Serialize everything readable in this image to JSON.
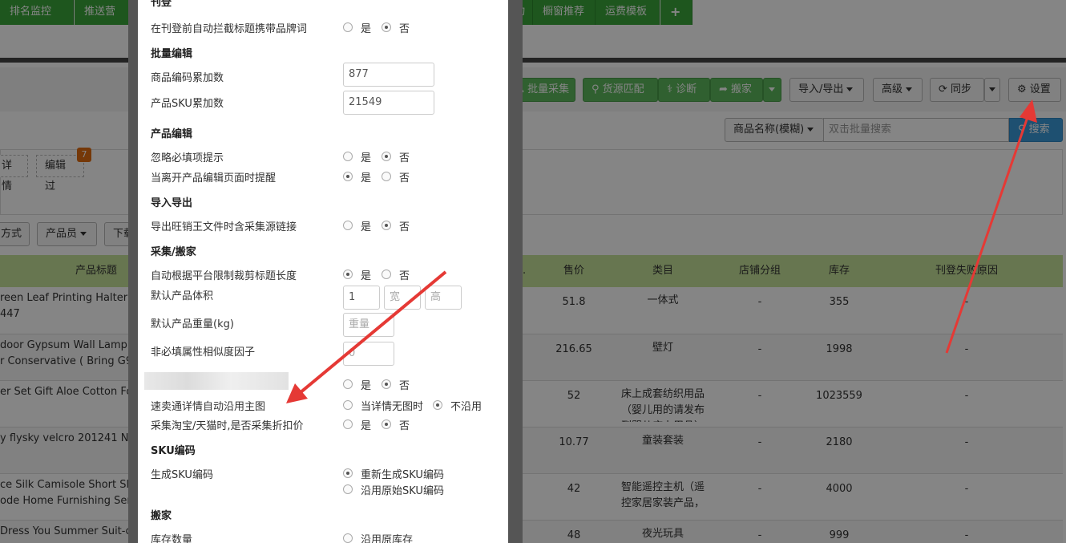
{
  "top_tabs": [
    "排名监控",
    "推送营销",
    "动",
    "橱窗推荐",
    "运费模板",
    "+"
  ],
  "toolbar": {
    "batch_collect": "批量采集",
    "source_match": "货源匹配",
    "diagnose": "诊断",
    "move": "搬家",
    "import_export": "导入/导出",
    "advanced": "高级",
    "sync": "同步",
    "settings": "设置"
  },
  "search": {
    "field_select": "商品名称(模糊)",
    "placeholder": "双击批量搜索",
    "button": "搜索"
  },
  "filters": {
    "detail_chip": "详情",
    "edited_chip": "编辑过",
    "edited_count": "7",
    "method_btn": "方式",
    "staff_btn": "产品员",
    "down_btn": "下载"
  },
  "grid": {
    "headers": {
      "title": "产品标题",
      "truncated": "...",
      "price": "售价",
      "category": "类目",
      "store_group": "店铺分组",
      "stock": "库存",
      "fail_reason": "刊登失败原因"
    },
    "rows": [
      {
        "title1": "reen Leaf Printing Halter C",
        "title2": "447",
        "price": "51.8",
        "category": "一体式",
        "group": "-",
        "stock": "355",
        "fail": "-"
      },
      {
        "title1": "door Gypsum Wall Lamp 1",
        "title2": "r Conservative ( Bring G9 l",
        "price": "216.65",
        "category": "壁灯",
        "group": "-",
        "stock": "1998",
        "fail": "-"
      },
      {
        "title1": "er Set Gift Aloe Cotton Fo",
        "title2": "",
        "price": "52",
        "category": "床上成套纺织用品（婴儿用的请发布到婴儿床上用品）",
        "group": "-",
        "stock": "1023559",
        "fail": "-"
      },
      {
        "title1": "y flysky velcro 201241 Non",
        "title2": "",
        "price": "10.77",
        "category": "童装套装",
        "group": "-",
        "stock": "2180",
        "fail": "-"
      },
      {
        "title1": "ce Silk Camisole Short Slee",
        "title2": "ode Home Furnishing Serv",
        "price": "42",
        "category": "智能遥控主机（遥控家居家装产品，",
        "group": "-",
        "stock": "4000",
        "fail": "-"
      },
      {
        "title1": "Dress You Summer Suit-c",
        "title2": "",
        "price": "48",
        "category": "夜光玩具",
        "group": "-",
        "stock": "999",
        "fail": "-"
      }
    ]
  },
  "modal": {
    "sections": {
      "publish": "刊登",
      "batch_edit": "批量编辑",
      "product_edit": "产品编辑",
      "import_export": "导入导出",
      "collect_move": "采集/搬家",
      "sku_code": "SKU编码",
      "move": "搬家"
    },
    "labels": {
      "block_brand": "在刊登前自动拦截标题携带品牌词",
      "code_increment": "商品编码累加数",
      "sku_increment": "产品SKU累加数",
      "ignore_required": "忽略必填项提示",
      "leave_remind": "当离开产品编辑页面时提醒",
      "export_link": "导出旺销王文件时含采集源链接",
      "auto_trim": "自动根据平台限制裁剪标题长度",
      "default_volume": "默认产品体积",
      "default_weight": "默认产品重量(kg)",
      "similarity": "非必填属性相似度因子",
      "main_image": "速卖通详情自动沿用主图",
      "discount_price": "采集淘宝/天猫时,是否采集折扣价",
      "gen_sku": "生成SKU编码",
      "stock_qty": "库存数量"
    },
    "options": {
      "yes": "是",
      "no": "否",
      "when_no_img": "当详情无图时",
      "not_use": "不沿用",
      "regen_sku": "重新生成SKU编码",
      "keep_sku": "沿用原始SKU编码",
      "keep_stock": "沿用原库存"
    },
    "values": {
      "code_increment": "877",
      "sku_increment": "21549",
      "volume_length": "1",
      "volume_width_ph": "宽",
      "volume_height_ph": "高",
      "weight_ph": "重量",
      "similarity": "0"
    }
  },
  "colors": {
    "nav_green": "#3aa63a",
    "grid_header_green": "#c6e39a",
    "btn_green": "#5cb85c",
    "btn_blue": "#3a99d8",
    "badge_orange": "#e06b10",
    "arrow_red": "#e53935"
  }
}
